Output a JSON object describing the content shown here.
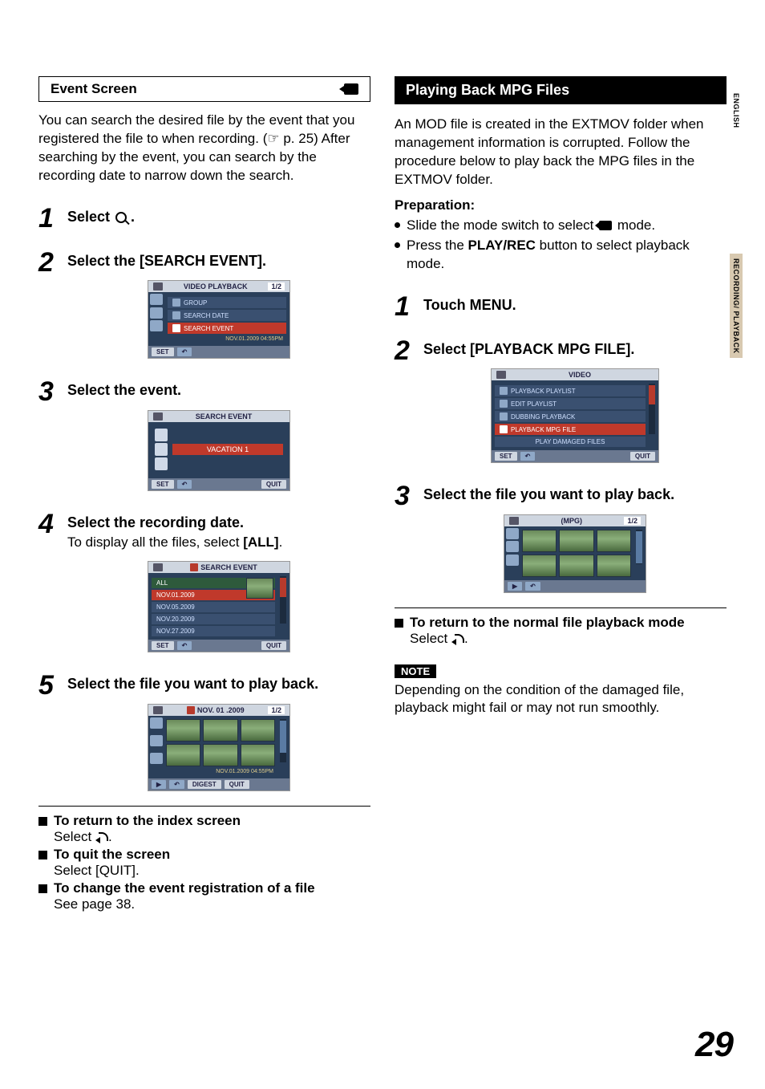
{
  "page_number": "29",
  "side_tabs": {
    "english": "ENGLISH",
    "section": "RECORDING/\nPLAYBACK"
  },
  "left": {
    "box_title": "Event Screen",
    "intro_1": "You can search the desired file by the event that you registered the file to when recording. (",
    "intro_pointer": "☞",
    "intro_2": " p. 25) After searching by the event, you can search by the recording date to narrow down the search.",
    "step1": {
      "title_prefix": "Select ",
      "title_suffix": " ."
    },
    "step2": {
      "title": "Select the [SEARCH EVENT]."
    },
    "ss1": {
      "header": "VIDEO PLAYBACK",
      "count": "1/2",
      "rows": [
        "GROUP",
        "SEARCH DATE",
        "SEARCH EVENT"
      ],
      "timestamp": "NOV.01.2009 04:55PM",
      "btn_set": "SET"
    },
    "step3": {
      "title": "Select the event."
    },
    "ss2": {
      "header": "SEARCH EVENT",
      "selected": "VACATION 1",
      "btn_set": "SET",
      "btn_quit": "QUIT"
    },
    "step4": {
      "title": "Select the recording date.",
      "sub1": "To display all the files, select ",
      "sub_all": "[ALL]",
      "sub2": "."
    },
    "ss3": {
      "header": "SEARCH EVENT",
      "rows": [
        "ALL",
        "NOV.01.2009",
        "NOV.05.2009",
        "NOV.20.2009",
        "NOV.27.2009"
      ],
      "btn_set": "SET",
      "btn_quit": "QUIT"
    },
    "step5": {
      "title": "Select the file you want to play back."
    },
    "ss4": {
      "header": "NOV. 01 .2009",
      "count": "1/2",
      "timestamp": "NOV.01.2009 04:55PM",
      "btn_digest": "DIGEST",
      "btn_quit": "QUIT"
    },
    "tips": {
      "t1_title": "To return to the index screen",
      "t1_body_prefix": "Select ",
      "t1_body_suffix": ".",
      "t2_title": "To quit the screen",
      "t2_body": "Select [QUIT].",
      "t3_title": "To change the event registration of a file",
      "t3_body": "See page 38."
    }
  },
  "right": {
    "header": "Playing Back MPG Files",
    "intro": "An MOD file is created in the EXTMOV folder when management information is corrupted. Follow the procedure below to play back the MPG files in the EXTMOV folder.",
    "prep_title": "Preparation:",
    "prep1_a": "Slide the mode switch to select ",
    "prep1_b": " mode.",
    "prep2_a": "Press the ",
    "prep2_bold": "PLAY/REC",
    "prep2_b": " button to select playback mode.",
    "step1": "Touch MENU.",
    "step2": "Select [PLAYBACK MPG FILE].",
    "ss1": {
      "header": "VIDEO",
      "rows": [
        "PLAYBACK PLAYLIST",
        "EDIT PLAYLIST",
        "DUBBING PLAYBACK",
        "PLAYBACK MPG FILE",
        "PLAY DAMAGED FILES"
      ],
      "btn_set": "SET",
      "btn_quit": "QUIT"
    },
    "step3": "Select the file you want to play back.",
    "ss2": {
      "header": "(MPG)",
      "count": "1/2"
    },
    "tip_title": "To return to the normal file playback mode",
    "tip_body_prefix": "Select ",
    "tip_body_suffix": ".",
    "note_label": "NOTE",
    "note_body": "Depending on the condition of the damaged file, playback might fail or may not run smoothly."
  }
}
